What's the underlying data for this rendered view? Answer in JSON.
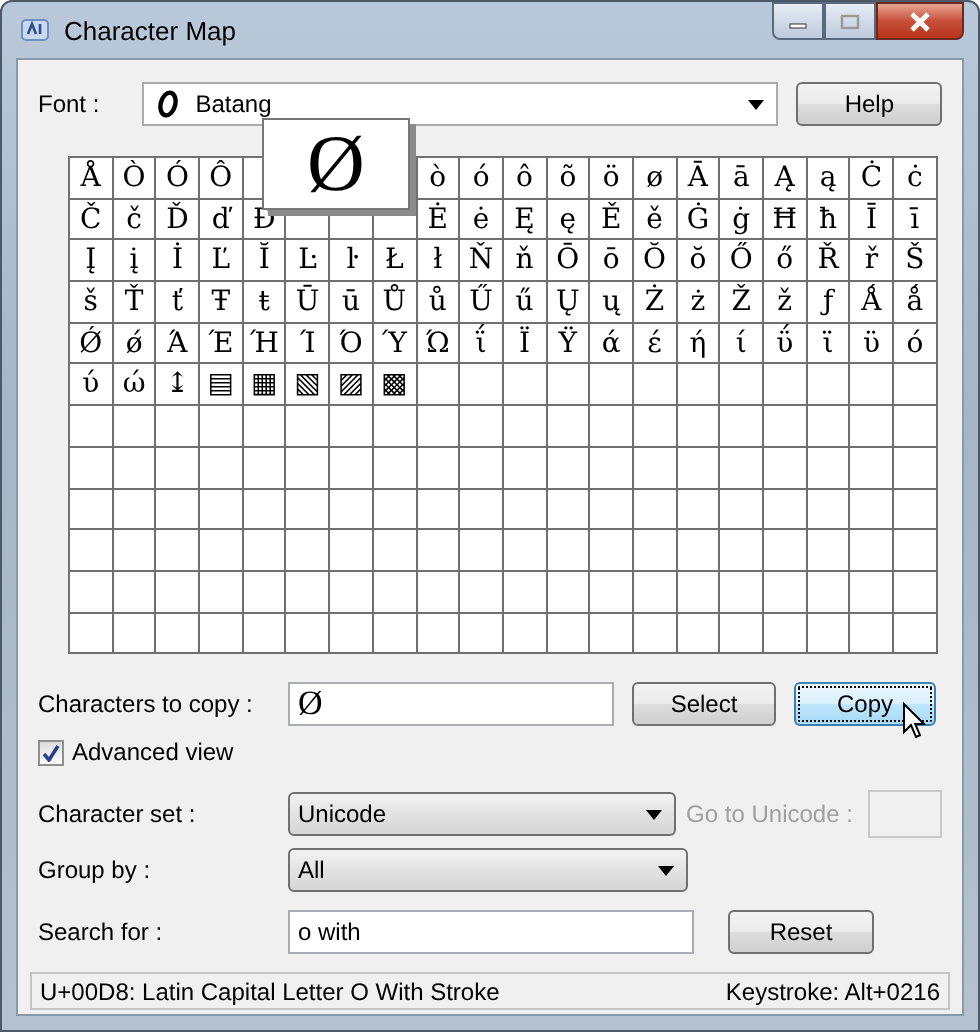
{
  "window": {
    "title": "Character Map"
  },
  "font": {
    "label": "Font :",
    "value": "Batang"
  },
  "help_button": "Help",
  "grid": {
    "preview": "Ø",
    "rows": [
      [
        "Å",
        "Ò",
        "Ó",
        "Ô",
        null,
        null,
        null,
        null,
        "ò",
        "ó",
        "ô",
        "õ",
        "ö",
        "ø",
        "Ā",
        "ā",
        "Ą",
        "ą",
        "Ċ",
        "ċ"
      ],
      [
        "Č",
        "č",
        "Ď",
        "ď",
        "Đ",
        null,
        null,
        null,
        "Ė",
        "ė",
        "Ę",
        "ę",
        "Ě",
        "ě",
        "Ġ",
        "ġ",
        "Ħ",
        "ħ",
        "Ī",
        "ī"
      ],
      [
        "Į",
        "į",
        "İ",
        "Ľ",
        "Ĭ",
        "Ŀ",
        "ŀ",
        "Ł",
        "ł",
        "Ň",
        "ň",
        "Ō",
        "ō",
        "Ŏ",
        "ŏ",
        "Ő",
        "ő",
        "Ř",
        "ř",
        "Š"
      ],
      [
        "š",
        "Ť",
        "ť",
        "Ŧ",
        "ŧ",
        "Ū",
        "ū",
        "Ů",
        "ů",
        "Ű",
        "ű",
        "Ų",
        "ų",
        "Ż",
        "ż",
        "Ž",
        "ž",
        "ƒ",
        "Ǻ",
        "ǻ"
      ],
      [
        "Ǿ",
        "ǿ",
        "Ά",
        "Έ",
        "Ή",
        "Ί",
        "Ό",
        "Ύ",
        "Ώ",
        "ΐ",
        "Ϊ",
        "Ϋ",
        "ά",
        "έ",
        "ή",
        "ί",
        "ΰ",
        "ϊ",
        "ϋ",
        "ό"
      ],
      [
        "ύ",
        "ώ",
        "↨",
        "▤",
        "▦",
        "▧",
        "▨",
        "▩"
      ]
    ]
  },
  "characters_to_copy": {
    "label": "Characters to copy :",
    "value": "Ø"
  },
  "select_button": "Select",
  "copy_button": {
    "label": "Copy",
    "focused": true
  },
  "advanced_view": {
    "label": "Advanced view",
    "checked": true
  },
  "character_set": {
    "label": "Character set :",
    "value": "Unicode"
  },
  "go_to_unicode": {
    "label": "Go to Unicode :",
    "disabled": true
  },
  "group_by": {
    "label": "Group by :",
    "value": "All"
  },
  "search_for": {
    "label": "Search for :",
    "value": "o with"
  },
  "reset_button": "Reset",
  "status_bar": {
    "description": "U+00D8: Latin Capital Letter O With Stroke",
    "keystroke": "Keystroke: Alt+0216"
  }
}
